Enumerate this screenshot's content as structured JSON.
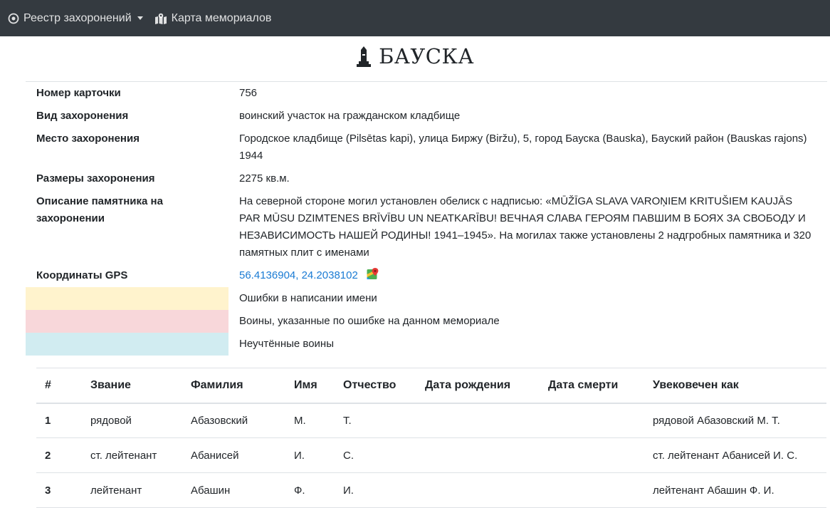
{
  "nav": {
    "registry_label": "Реестр захоронений",
    "map_label": "Карта мемориалов"
  },
  "page": {
    "title": "БАУСКА"
  },
  "info": [
    {
      "label": "Номер карточки",
      "value": "756"
    },
    {
      "label": "Вид захоронения",
      "value": "воинский участок на гражданском кладбище"
    },
    {
      "label": "Место захоронения",
      "value": "Городское кладбище (Pilsētas kapi), улица Биржу (Biržu), 5, город Бауска (Bauska), Бауский район (Bauskas rajons) 1944"
    },
    {
      "label": "Размеры захоронения",
      "value": "2275 кв.м."
    },
    {
      "label": "Описание памятника на захоронении",
      "value": "На северной стороне могил установлен обелиск с надписью: «MŪŽĪGA SLAVA VAROŅIEM KRITUŠIEM KAUJĀS PAR MŪSU DZIMTENES BRĪVĪBU UN NEATKARĪBU! ВЕЧНАЯ СЛАВА ГЕРОЯМ ПАВШИМ В БОЯХ ЗА СВОБОДУ И НЕЗАВИСИМОСТЬ НАШЕЙ РОДИНЫ! 1941–1945». На могилах также установлены 2 надгробных памятника и 320 памятных плит с именами"
    },
    {
      "label": "Координаты GPS",
      "value": "56.4136904, 24.2038102"
    }
  ],
  "legend": [
    {
      "color": "#fff3cd",
      "text": "Ошибки в написании имени"
    },
    {
      "color": "#f8d7da",
      "text": "Воины, указанные по ошибке на данном мемориале"
    },
    {
      "color": "#d1ecf1",
      "text": "Неучтённые воины"
    }
  ],
  "table": {
    "columns": [
      "#",
      "Звание",
      "Фамилия",
      "Имя",
      "Отчество",
      "Дата рождения",
      "Дата смерти",
      "Увековечен как"
    ],
    "rows": [
      [
        "1",
        "рядовой",
        "Абазовский",
        "М.",
        "Т.",
        "",
        "",
        "рядовой Абазовский М. Т."
      ],
      [
        "2",
        "ст. лейтенант",
        "Абанисей",
        "И.",
        "С.",
        "",
        "",
        "ст. лейтенант Абанисей И. С."
      ],
      [
        "3",
        "лейтенант",
        "Абашин",
        "Ф.",
        "И.",
        "",
        "",
        "лейтенант Абашин Ф. И."
      ]
    ]
  }
}
